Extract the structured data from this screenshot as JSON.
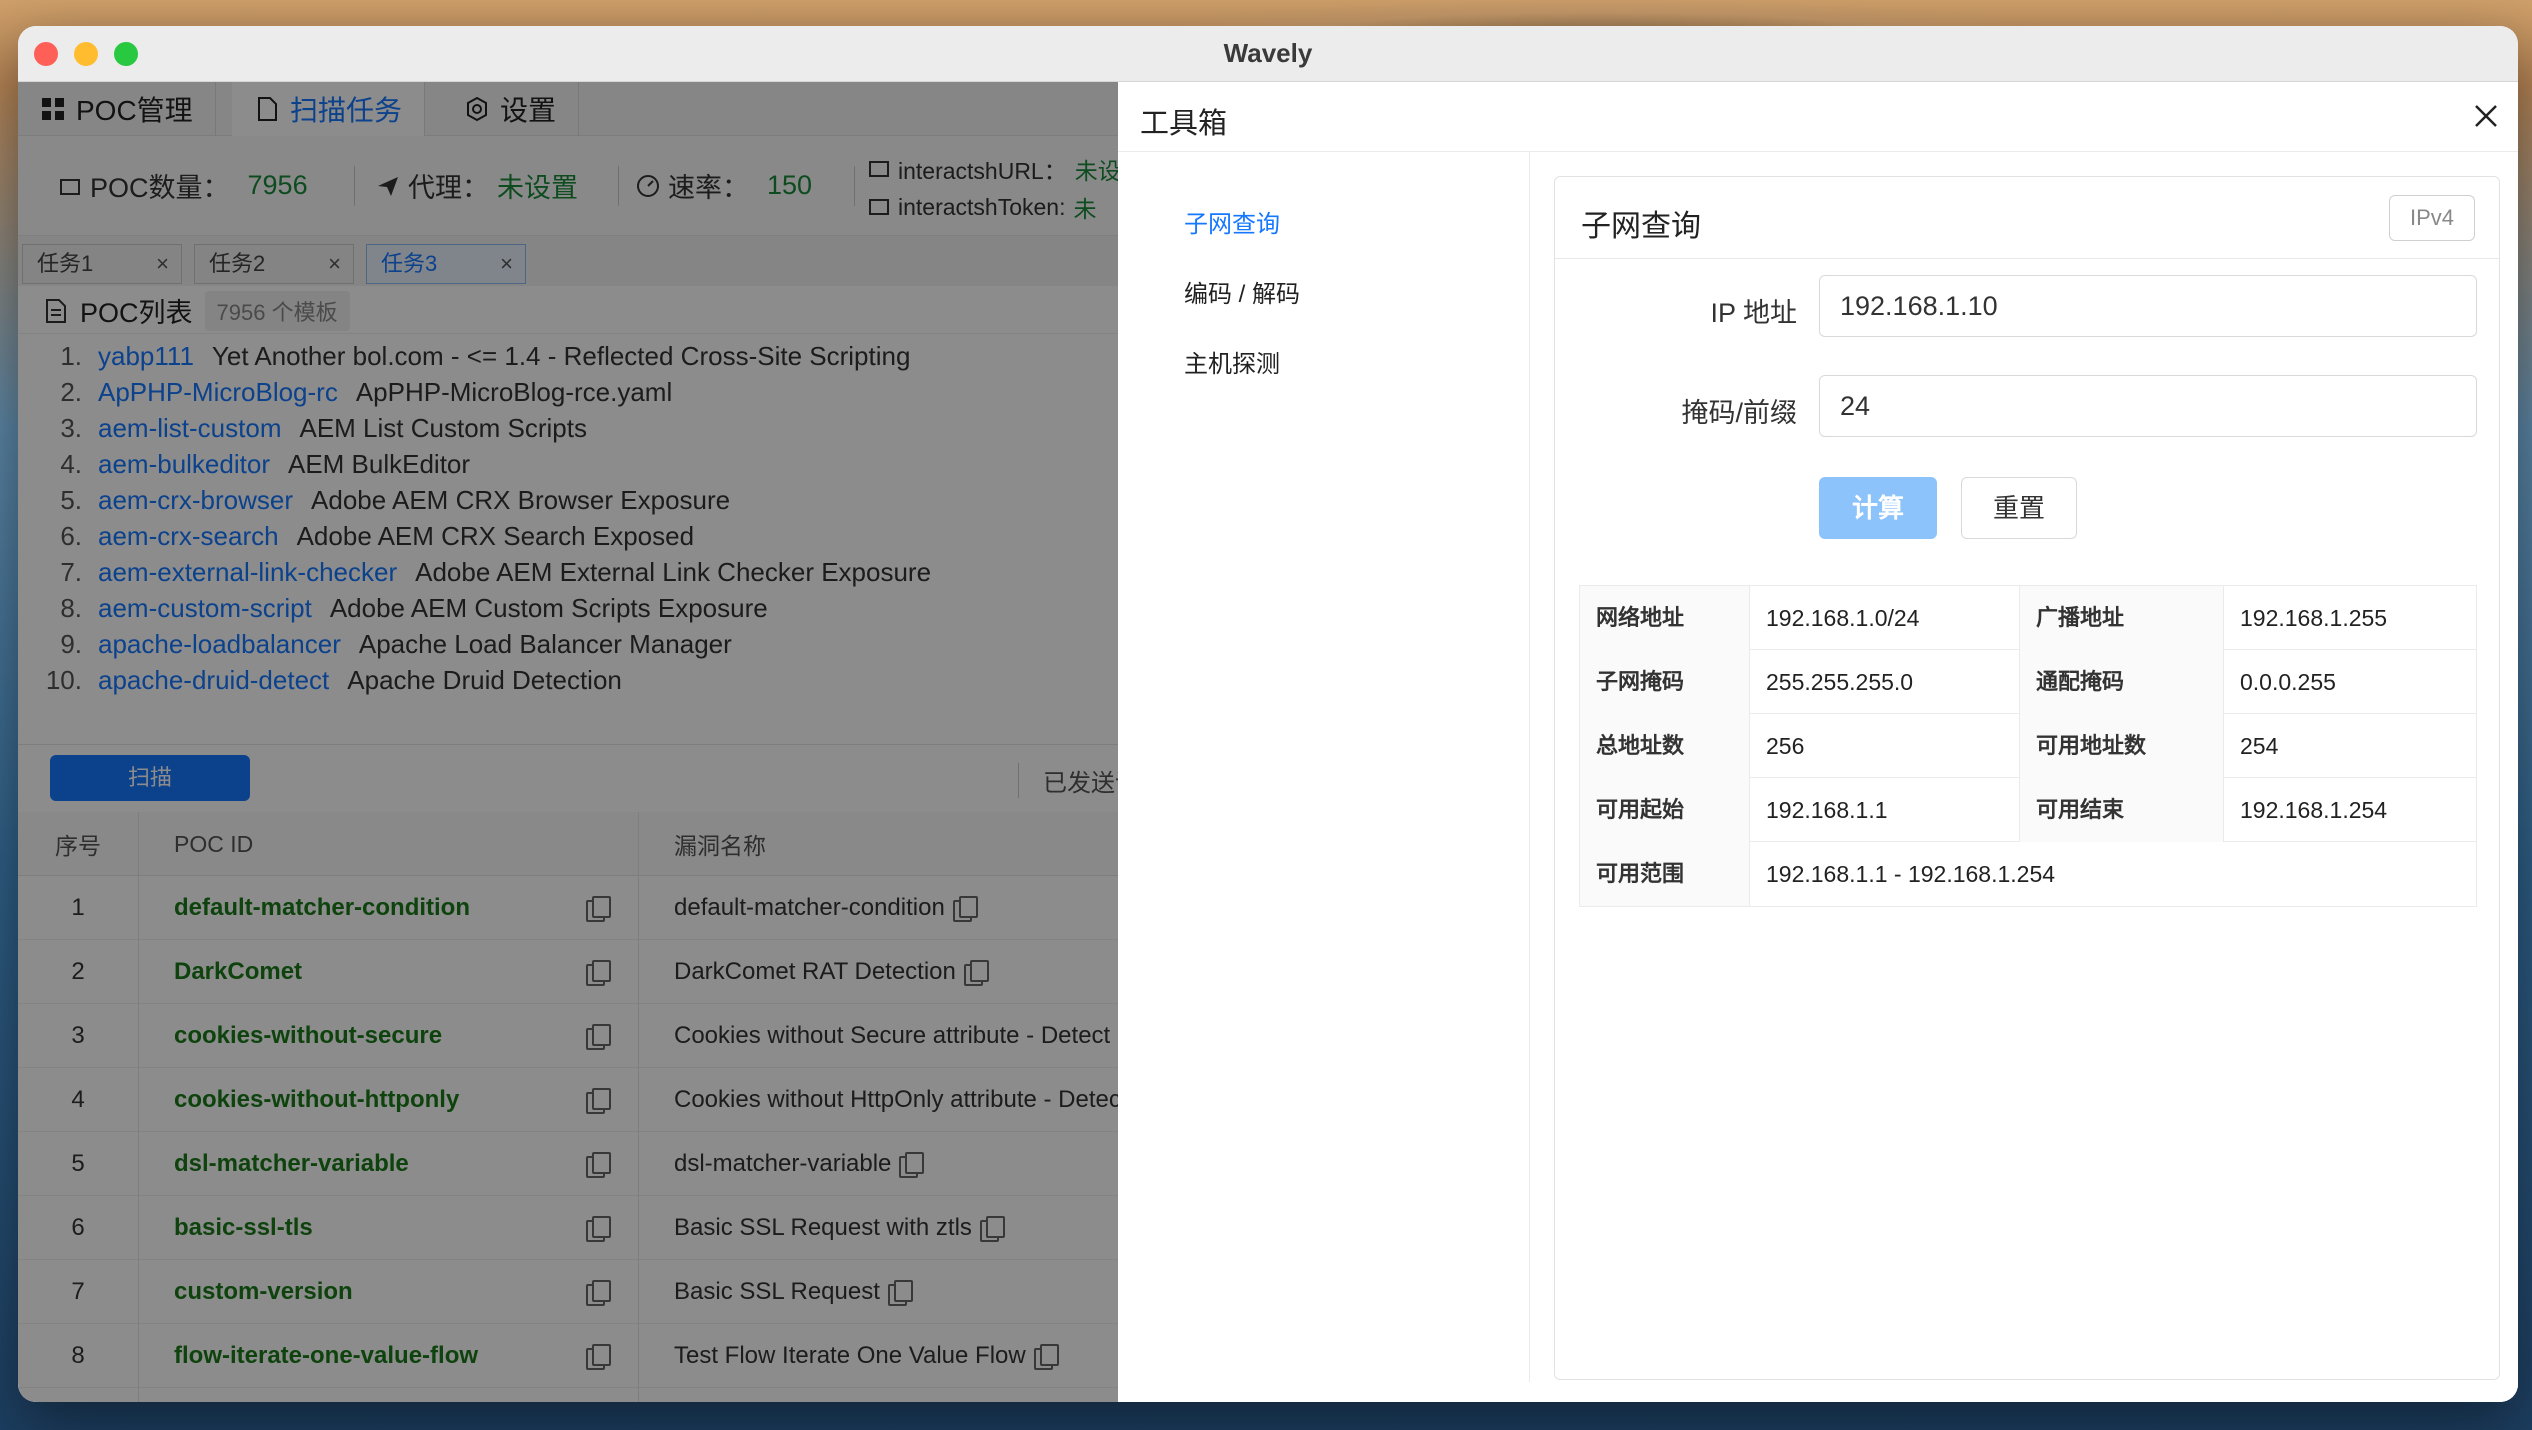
{
  "window": {
    "title": "Wavely"
  },
  "nav": {
    "tabs": [
      {
        "label": "POC管理",
        "icon": "grid-icon"
      },
      {
        "label": "扫描任务",
        "icon": "document-icon"
      },
      {
        "label": "设置",
        "icon": "gear-icon"
      }
    ],
    "active_tab": "扫描任务"
  },
  "stats": {
    "poc_count_label": "POC数量：",
    "poc_count_value": "7956",
    "proxy_label": "代理：",
    "proxy_value": "未设置",
    "rate_label": "速率：",
    "rate_value": "150",
    "interactsh_url_label": "interactshURL：",
    "interactsh_url_value": "未设",
    "interactsh_token_label": "interactshToken:",
    "interactsh_token_value": "未"
  },
  "task_tabs": [
    {
      "label": "任务1"
    },
    {
      "label": "任务2"
    },
    {
      "label": "任务3",
      "active": true
    }
  ],
  "poc_list": {
    "title": "POC列表",
    "count": "7956 个模板",
    "items": [
      {
        "num": "1.",
        "id": "yabp111",
        "name": "Yet Another bol.com - <= 1.4 - Reflected Cross-Site Scripting"
      },
      {
        "num": "2.",
        "id": "ApPHP-MicroBlog-rc",
        "name": "ApPHP-MicroBlog-rce.yaml"
      },
      {
        "num": "3.",
        "id": "aem-list-custom",
        "name": "AEM List Custom Scripts"
      },
      {
        "num": "4.",
        "id": "aem-bulkeditor",
        "name": "AEM BulkEditor"
      },
      {
        "num": "5.",
        "id": "aem-crx-browser",
        "name": "Adobe AEM CRX Browser Exposure"
      },
      {
        "num": "6.",
        "id": "aem-crx-search",
        "name": "Adobe AEM CRX Search Exposed"
      },
      {
        "num": "7.",
        "id": "aem-external-link-checker",
        "name": "Adobe AEM External Link Checker Exposure"
      },
      {
        "num": "8.",
        "id": "aem-custom-script",
        "name": "Adobe AEM Custom Scripts Exposure"
      },
      {
        "num": "9.",
        "id": "apache-loadbalancer",
        "name": "Apache Load Balancer Manager"
      },
      {
        "num": "10.",
        "id": "apache-druid-detect",
        "name": "Apache Druid Detection"
      }
    ]
  },
  "actions": {
    "scan_label": "扫描",
    "sent_label": "已发送请"
  },
  "results": {
    "headers": {
      "no": "序号",
      "poc_id": "POC ID",
      "vuln_name": "漏洞名称"
    },
    "rows": [
      {
        "no": "1",
        "poc_id": "default-matcher-condition",
        "name": "default-matcher-condition"
      },
      {
        "no": "2",
        "poc_id": "DarkComet",
        "name": "DarkComet RAT Detection"
      },
      {
        "no": "3",
        "poc_id": "cookies-without-secure",
        "name": "Cookies without Secure attribute - Detect"
      },
      {
        "no": "4",
        "poc_id": "cookies-without-httponly",
        "name": "Cookies without HttpOnly attribute - Detect"
      },
      {
        "no": "5",
        "poc_id": "dsl-matcher-variable",
        "name": "dsl-matcher-variable"
      },
      {
        "no": "6",
        "poc_id": "basic-ssl-tls",
        "name": "Basic SSL Request with ztls"
      },
      {
        "no": "7",
        "poc_id": "custom-version",
        "name": "Basic SSL Request"
      },
      {
        "no": "8",
        "poc_id": "flow-iterate-one-value-flow",
        "name": "Test Flow Iterate One Value Flow"
      }
    ]
  },
  "toolbox": {
    "title": "工具箱",
    "menu": [
      {
        "label": "子网查询",
        "active": true
      },
      {
        "label": "编码 / 解码"
      },
      {
        "label": "主机探测"
      }
    ],
    "subnet": {
      "title": "子网查询",
      "tag": "IPv4",
      "ip_label": "IP 地址",
      "ip_value": "192.168.1.10",
      "mask_label": "掩码/前缀",
      "mask_value": "24",
      "calc_label": "计算",
      "reset_label": "重置",
      "results": {
        "network_label": "网络地址",
        "network_value": "192.168.1.0/24",
        "broadcast_label": "广播地址",
        "broadcast_value": "192.168.1.255",
        "netmask_label": "子网掩码",
        "netmask_value": "255.255.255.0",
        "wildcard_label": "通配掩码",
        "wildcard_value": "0.0.0.255",
        "total_label": "总地址数",
        "total_value": "256",
        "usable_label": "可用地址数",
        "usable_value": "254",
        "first_label": "可用起始",
        "first_value": "192.168.1.1",
        "last_label": "可用结束",
        "last_value": "192.168.1.254",
        "range_label": "可用范围",
        "range_value": "192.168.1.1 - 192.168.1.254"
      }
    }
  },
  "colors": {
    "accent": "#1677ff",
    "success": "#1b8a3b",
    "calc_button": "#8cc3fb"
  }
}
